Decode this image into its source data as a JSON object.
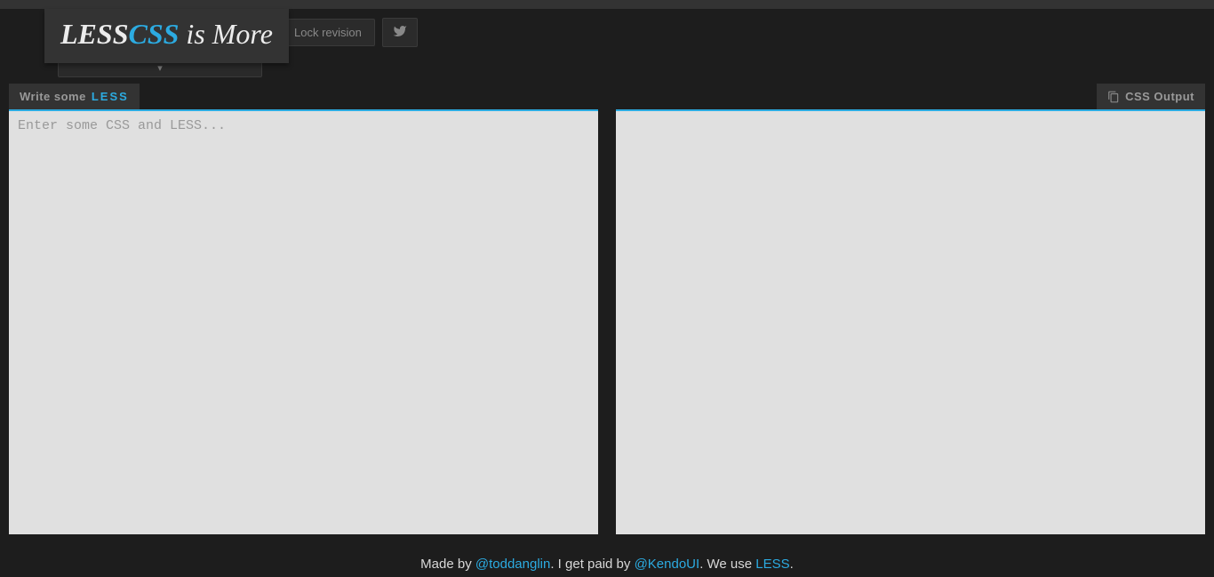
{
  "header": {
    "logo": {
      "part1": "LESS",
      "part2": "CSS",
      "part3": " is More"
    },
    "lock_label": "Lock revision",
    "dropdown_indicator": "▾"
  },
  "panels": {
    "input": {
      "header_prefix": "Write some ",
      "header_less": "LESS",
      "placeholder": "Enter some CSS and LESS..."
    },
    "output": {
      "header": "CSS Output"
    }
  },
  "footer": {
    "made_by_text": "Made by ",
    "made_by_link": "@toddanglin",
    "paid_text": ". I get paid by ",
    "paid_link": "@KendoUI",
    "use_text": ". We use ",
    "use_link": "LESS",
    "end": "."
  }
}
